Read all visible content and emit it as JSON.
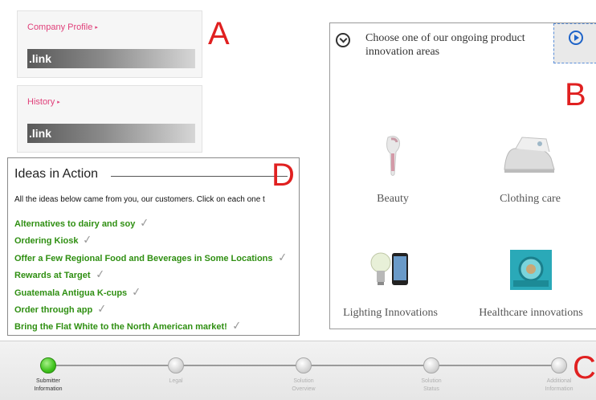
{
  "panel_a": {
    "letter": "A",
    "cards": [
      {
        "title": "Company Profile",
        "link_label": ".link"
      },
      {
        "title": "History",
        "link_label": ".link"
      }
    ]
  },
  "panel_b": {
    "letter": "B",
    "prompt": "Choose one of our ongoing product innovation areas",
    "categories": [
      {
        "label": "Beauty"
      },
      {
        "label": "Clothing care"
      },
      {
        "label": "Lighting Innovations"
      },
      {
        "label": "Healthcare innovations"
      }
    ]
  },
  "panel_d": {
    "letter": "D",
    "title": "Ideas in Action",
    "intro": "All the ideas below came from you, our customers. Click on each one t",
    "ideas": [
      "Alternatives to dairy and soy",
      "Ordering Kiosk",
      "Offer a Few Regional Food and Beverages in Some Locations",
      "Rewards at Target",
      "Guatemala Antigua K-cups",
      "Order through app",
      "Bring the Flat White to the North American market!"
    ]
  },
  "progress": {
    "letter": "C",
    "active_step": "Submitter Information",
    "steps": [
      {
        "line1": "Submitter",
        "line2": "Information"
      },
      {
        "line1": "Legal",
        "line2": ""
      },
      {
        "line1": "Solution",
        "line2": "Overview"
      },
      {
        "line1": "Solution",
        "line2": "Status"
      },
      {
        "line1": "Additional",
        "line2": "Information"
      }
    ]
  },
  "colors": {
    "link_pink": "#e0407a",
    "idea_green": "#2f8f12",
    "letter_red": "#e02020",
    "accent_blue": "#1e63c8",
    "active_step_green": "#3ec31c"
  },
  "icons": {
    "prompt_icon": "chevron-down-circle-icon",
    "next_icon": "play-circle-icon",
    "idea_check": "checkmark-icon"
  }
}
